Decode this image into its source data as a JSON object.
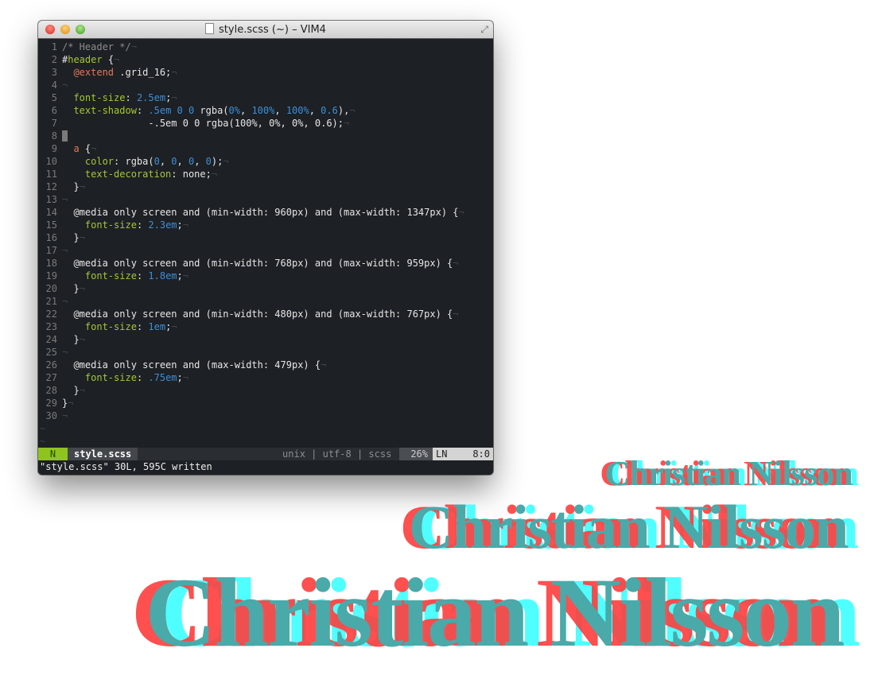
{
  "window": {
    "title": "style.scss (~) – VIM4"
  },
  "code_lines": [
    [
      [
        "/* Header */",
        "c"
      ],
      [
        "¬",
        "e"
      ]
    ],
    [
      [
        "#",
        "w"
      ],
      [
        "header",
        "g"
      ],
      [
        " {",
        "w"
      ],
      [
        "¬",
        "e"
      ]
    ],
    [
      [
        "  ",
        "w"
      ],
      [
        "@extend",
        "o"
      ],
      [
        " .grid_16;",
        "w"
      ],
      [
        "¬",
        "e"
      ]
    ],
    [
      [
        "¬",
        "e"
      ]
    ],
    [
      [
        "  ",
        "w"
      ],
      [
        "font-size",
        "g"
      ],
      [
        ": ",
        "w"
      ],
      [
        "2.5em",
        "b"
      ],
      [
        ";",
        "w"
      ],
      [
        "¬",
        "e"
      ]
    ],
    [
      [
        "  ",
        "w"
      ],
      [
        "text-shadow",
        "g"
      ],
      [
        ": ",
        "w"
      ],
      [
        ".5em 0 0",
        "b"
      ],
      [
        " rgba(",
        "w"
      ],
      [
        "0%",
        "b"
      ],
      [
        ", ",
        "w"
      ],
      [
        "100%",
        "b"
      ],
      [
        ", ",
        "w"
      ],
      [
        "100%",
        "b"
      ],
      [
        ", ",
        "w"
      ],
      [
        "0.6",
        "b"
      ],
      [
        "),",
        "w"
      ],
      [
        "¬",
        "e"
      ]
    ],
    [
      [
        "               -.5em 0 0 rgba(100%, 0%, 0%, 0.6);",
        "w"
      ],
      [
        "¬",
        "e"
      ]
    ],
    [
      [
        "¬",
        "cursor"
      ]
    ],
    [
      [
        "  ",
        "w"
      ],
      [
        "a",
        "o"
      ],
      [
        " {",
        "w"
      ],
      [
        "¬",
        "e"
      ]
    ],
    [
      [
        "    ",
        "w"
      ],
      [
        "color",
        "g"
      ],
      [
        ": rgba(",
        "w"
      ],
      [
        "0",
        "b"
      ],
      [
        ", ",
        "w"
      ],
      [
        "0",
        "b"
      ],
      [
        ", ",
        "w"
      ],
      [
        "0",
        "b"
      ],
      [
        ", ",
        "w"
      ],
      [
        "0",
        "b"
      ],
      [
        ");",
        "w"
      ],
      [
        "¬",
        "e"
      ]
    ],
    [
      [
        "    ",
        "w"
      ],
      [
        "text-decoration",
        "g"
      ],
      [
        ": none;",
        "w"
      ],
      [
        "¬",
        "e"
      ]
    ],
    [
      [
        "  }",
        "w"
      ],
      [
        "¬",
        "e"
      ]
    ],
    [
      [
        "¬",
        "e"
      ]
    ],
    [
      [
        "  @media only screen and (min-width: 960px) and (max-width: 1347px) {",
        "w"
      ],
      [
        "¬",
        "e"
      ]
    ],
    [
      [
        "    ",
        "w"
      ],
      [
        "font-size",
        "g"
      ],
      [
        ": ",
        "w"
      ],
      [
        "2.3em",
        "b"
      ],
      [
        ";",
        "w"
      ],
      [
        "¬",
        "e"
      ]
    ],
    [
      [
        "  }",
        "w"
      ],
      [
        "¬",
        "e"
      ]
    ],
    [
      [
        "¬",
        "e"
      ]
    ],
    [
      [
        "  @media only screen and (min-width: 768px) and (max-width: 959px) {",
        "w"
      ],
      [
        "¬",
        "e"
      ]
    ],
    [
      [
        "    ",
        "w"
      ],
      [
        "font-size",
        "g"
      ],
      [
        ": ",
        "w"
      ],
      [
        "1.8em",
        "b"
      ],
      [
        ";",
        "w"
      ],
      [
        "¬",
        "e"
      ]
    ],
    [
      [
        "  }",
        "w"
      ],
      [
        "¬",
        "e"
      ]
    ],
    [
      [
        "¬",
        "e"
      ]
    ],
    [
      [
        "  @media only screen and (min-width: 480px) and (max-width: 767px) {",
        "w"
      ],
      [
        "¬",
        "e"
      ]
    ],
    [
      [
        "    ",
        "w"
      ],
      [
        "font-size",
        "g"
      ],
      [
        ": ",
        "w"
      ],
      [
        "1em",
        "b"
      ],
      [
        ";",
        "w"
      ],
      [
        "¬",
        "e"
      ]
    ],
    [
      [
        "  }",
        "w"
      ],
      [
        "¬",
        "e"
      ]
    ],
    [
      [
        "¬",
        "e"
      ]
    ],
    [
      [
        "  @media only screen and (max-width: 479px) {",
        "w"
      ],
      [
        "¬",
        "e"
      ]
    ],
    [
      [
        "    ",
        "w"
      ],
      [
        "font-size",
        "g"
      ],
      [
        ": ",
        "w"
      ],
      [
        ".75em",
        "b"
      ],
      [
        ";",
        "w"
      ],
      [
        "¬",
        "e"
      ]
    ],
    [
      [
        "  }",
        "w"
      ],
      [
        "¬",
        "e"
      ]
    ],
    [
      [
        "}",
        "w"
      ],
      [
        "¬",
        "e"
      ]
    ],
    [
      [
        "¬",
        "e"
      ]
    ]
  ],
  "tilde": "~",
  "statusline": {
    "mode": "N",
    "filename": "style.scss",
    "info": "unix | utf-8 | scss",
    "percent": "26%",
    "ln_label": "LN",
    "position": "8:0"
  },
  "command_line": "\"style.scss\" 30L, 595C written",
  "brand_text": "Christian Nilsson"
}
